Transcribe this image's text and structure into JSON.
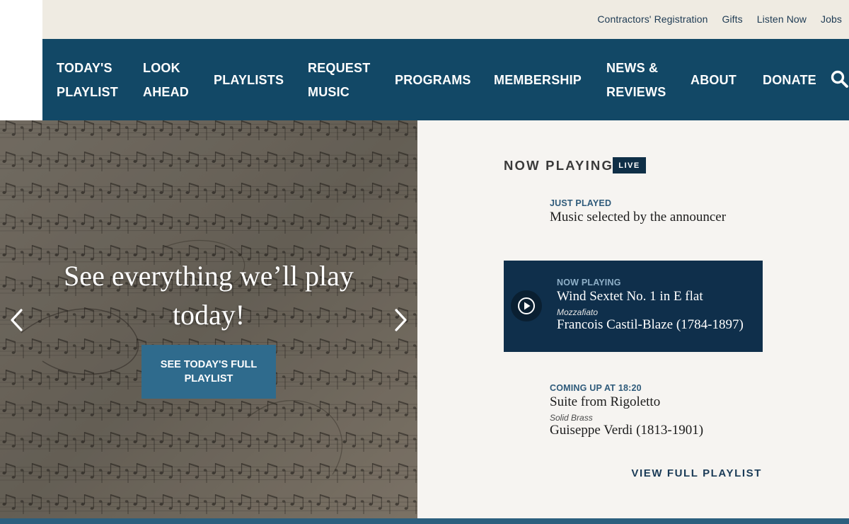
{
  "utility_nav": {
    "links": [
      "Contractors' Registration",
      "Gifts",
      "Listen Now",
      "Jobs"
    ]
  },
  "main_nav": {
    "items": [
      "TODAY'S\nPLAYLIST",
      "LOOK\nAHEAD",
      "PLAYLISTS",
      "REQUEST\nMUSIC",
      "PROGRAMS",
      "MEMBERSHIP",
      "NEWS &\nREVIEWS",
      "ABOUT",
      "DONATE"
    ],
    "search_icon": "search-icon"
  },
  "hero": {
    "title": "See everything we’ll play today!",
    "cta_label": "SEE TODAY'S FULL PLAYLIST",
    "prev_icon": "chevron-left-icon",
    "next_icon": "chevron-right-icon"
  },
  "now_playing": {
    "heading": "NOW PLAYING",
    "live_badge": "LIVE",
    "just_played": {
      "label": "JUST PLAYED",
      "title": "Music selected by the announcer"
    },
    "current": {
      "label": "NOW PLAYING",
      "title": "Wind Sextet No. 1 in E flat",
      "ensemble": "Mozzafiato",
      "composer": "Francois Castil-Blaze (1784-1897)",
      "play_icon": "play-circle-icon"
    },
    "coming_up": {
      "label": "COMING UP AT 18:20",
      "title": "Suite from Rigoletto",
      "ensemble": "Solid Brass",
      "composer": "Guiseppe Verdi (1813-1901)"
    },
    "view_full_label": "VIEW FULL PLAYLIST"
  },
  "colors": {
    "utility_bg": "#efebe2",
    "nav_bg": "#124866",
    "cta_bg": "#2f6b8d",
    "now_card_bg": "#0f2f4b",
    "panel_bg": "#f6f4f1"
  }
}
